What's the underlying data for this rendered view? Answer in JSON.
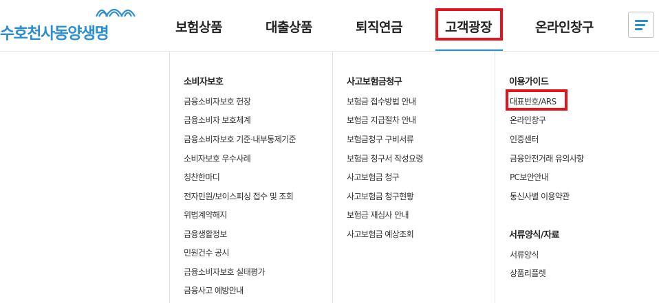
{
  "brand": {
    "name": "수호천사동양생명",
    "accent_color": "#2a8fd0",
    "highlight_color": "#e3141b"
  },
  "nav": {
    "items": [
      {
        "label": "보험상품"
      },
      {
        "label": "대출상품"
      },
      {
        "label": "퇴직연금"
      },
      {
        "label": "고객광장",
        "active": true
      },
      {
        "label": "온라인창구"
      }
    ],
    "menu_icon": "hamburger-menu-icon"
  },
  "dropdown": {
    "columns": [
      {
        "heading": "소비자보호",
        "items": [
          "금융소비자보호 헌장",
          "금융소비자 보호체계",
          "금융소비자보호 기준·내부통제기준",
          "소비자보호 우수사례",
          "칭찬한마디",
          "전자민원/보이스피싱 접수 및 조회",
          "위법계약해지",
          "금융생활정보",
          "민원건수 공시",
          "금융소비자보호 실태평가",
          "금융사고 예방안내"
        ]
      },
      {
        "heading": "사고보험금청구",
        "items": [
          "보험금 접수방법 안내",
          "보험금 지급절차 안내",
          "보험금청구 구비서류",
          "보험금 청구서 작성요령",
          "사고보험금 청구",
          "사고보험금 청구현황",
          "보험금 재심사 안내",
          "사고보험금 예상조회"
        ]
      },
      {
        "heading": "이용가이드",
        "items": [
          "대표번호/ARS",
          "온라인창구",
          "인증센터",
          "금융안전거래 유의사항",
          "PC보안안내",
          "통신사별 이용약관"
        ],
        "highlighted_item": "대표번호/ARS",
        "heading2": "서류양식/자료",
        "items2": [
          "서류양식",
          "상품리플렛"
        ]
      }
    ]
  }
}
